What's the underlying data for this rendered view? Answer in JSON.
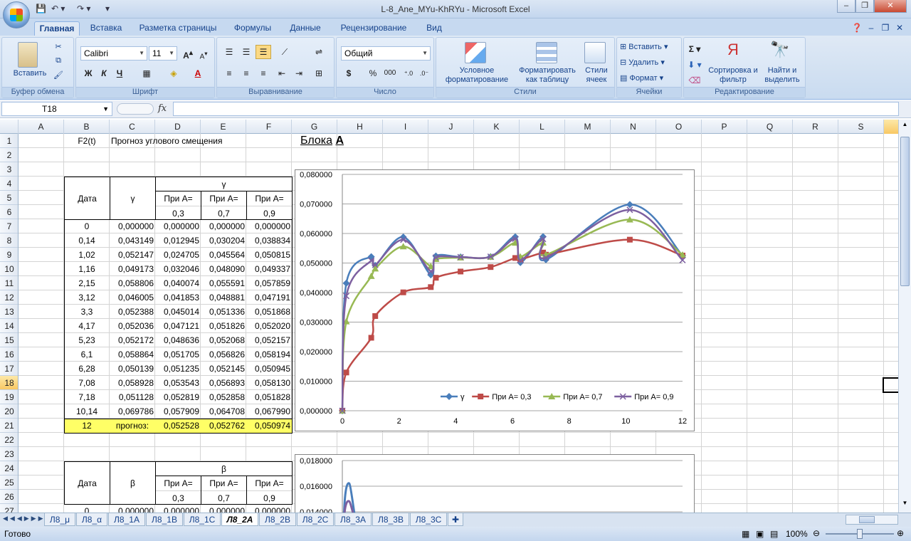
{
  "window": {
    "title": "L-8_Ane_MYu-KhRYu - Microsoft Excel",
    "min": "‒",
    "max": "❐",
    "close": "✕"
  },
  "ribbon": {
    "tabs": [
      "Главная",
      "Вставка",
      "Разметка страницы",
      "Формулы",
      "Данные",
      "Рецензирование",
      "Вид"
    ],
    "clipboard": {
      "paste": "Вставить",
      "label": "Буфер обмена"
    },
    "font": {
      "name": "Calibri",
      "size": "11",
      "label": "Шрифт",
      "bold": "Ж",
      "italic": "К",
      "underline": "Ч"
    },
    "alignment": {
      "label": "Выравнивание"
    },
    "number": {
      "format": "Общий",
      "label": "Число",
      "percent": "%",
      "thousands": "000"
    },
    "styles": {
      "conditional": "Условное форматирование",
      "as_table": "Форматировать как таблицу",
      "cell_styles": "Стили ячеек",
      "label": "Стили"
    },
    "cells": {
      "insert": "Вставить",
      "delete": "Удалить",
      "format": "Формат",
      "label": "Ячейки"
    },
    "editing": {
      "sort": "Сортировка и фильтр",
      "find": "Найти и выделить",
      "label": "Редактирование"
    }
  },
  "formula_bar": {
    "name_box": "T18",
    "fx": "fx",
    "value": ""
  },
  "columns": [
    "A",
    "B",
    "C",
    "D",
    "E",
    "F",
    "G",
    "H",
    "I",
    "J",
    "K",
    "L",
    "M",
    "N",
    "O",
    "P",
    "Q",
    "R",
    "S",
    "T"
  ],
  "selected_column": "T",
  "selected_row": "18",
  "rows": [
    "1",
    "2",
    "3",
    "4",
    "5",
    "6",
    "7",
    "8",
    "9",
    "10",
    "11",
    "12",
    "13",
    "14",
    "15",
    "16",
    "17",
    "18",
    "19",
    "20",
    "21",
    "22",
    "23",
    "24",
    "25",
    "26",
    "27"
  ],
  "sheet": {
    "b1": "F2(t)",
    "c1": "Прогноз углового смещения",
    "g1a": "Блока",
    "g1b": "А",
    "table1": {
      "gamma_header": "γ",
      "col_date": "Дата",
      "col_gamma": "γ",
      "pri_a": "При А=",
      "a_values": [
        "0,3",
        "0,7",
        "0,9"
      ],
      "rows": [
        [
          "0",
          "0,000000",
          "0,000000",
          "0,000000",
          "0,000000"
        ],
        [
          "0,14",
          "0,043149",
          "0,012945",
          "0,030204",
          "0,038834"
        ],
        [
          "1,02",
          "0,052147",
          "0,024705",
          "0,045564",
          "0,050815"
        ],
        [
          "1,16",
          "0,049173",
          "0,032046",
          "0,048090",
          "0,049337"
        ],
        [
          "2,15",
          "0,058806",
          "0,040074",
          "0,055591",
          "0,057859"
        ],
        [
          "3,12",
          "0,046005",
          "0,041853",
          "0,048881",
          "0,047191"
        ],
        [
          "3,3",
          "0,052388",
          "0,045014",
          "0,051336",
          "0,051868"
        ],
        [
          "4,17",
          "0,052036",
          "0,047121",
          "0,051826",
          "0,052020"
        ],
        [
          "5,23",
          "0,052172",
          "0,048636",
          "0,052068",
          "0,052157"
        ],
        [
          "6,1",
          "0,058864",
          "0,051705",
          "0,056826",
          "0,058194"
        ],
        [
          "6,28",
          "0,050139",
          "0,051235",
          "0,052145",
          "0,050945"
        ],
        [
          "7,08",
          "0,058928",
          "0,053543",
          "0,056893",
          "0,058130"
        ],
        [
          "7,18",
          "0,051128",
          "0,052819",
          "0,052858",
          "0,051828"
        ],
        [
          "10,14",
          "0,069786",
          "0,057909",
          "0,064708",
          "0,067990"
        ]
      ],
      "forecast": [
        "12",
        "прогноз:",
        "0,052528",
        "0,052762",
        "0,050974"
      ]
    },
    "table2": {
      "beta_header": "β",
      "col_date": "Дата",
      "col_beta": "β",
      "pri_a": "При А=",
      "a_values": [
        "0,3",
        "0,7",
        "0,9"
      ],
      "partial_row": [
        "0",
        "0,000000",
        "0,000000",
        "0,000000",
        "0,000000"
      ]
    }
  },
  "chart_data": [
    {
      "type": "scatter",
      "title": "",
      "xlabel": "",
      "ylabel": "",
      "xlim": [
        0,
        12
      ],
      "ylim": [
        0,
        0.08
      ],
      "x_ticks": [
        "0",
        "2",
        "4",
        "6",
        "8",
        "10",
        "12"
      ],
      "y_ticks": [
        "0,000000",
        "0,010000",
        "0,020000",
        "0,030000",
        "0,040000",
        "0,050000",
        "0,060000",
        "0,070000",
        "0,080000"
      ],
      "grid": true,
      "legend": "bottom-right",
      "x": [
        0,
        0.14,
        1.02,
        1.16,
        2.15,
        3.12,
        3.3,
        4.17,
        5.23,
        6.1,
        6.28,
        7.08,
        7.18,
        10.14,
        12
      ],
      "series": [
        {
          "name": "γ",
          "color": "#4a7ebb",
          "marker": "diamond",
          "values": [
            0,
            0.043149,
            0.052147,
            0.049173,
            0.058806,
            0.046005,
            0.052388,
            0.052036,
            0.052172,
            0.058864,
            0.050139,
            0.058928,
            0.051128,
            0.069786,
            0.052528
          ]
        },
        {
          "name": "При А= 0,3",
          "color": "#be4b48",
          "marker": "square",
          "values": [
            0,
            0.012945,
            0.024705,
            0.032046,
            0.040074,
            0.041853,
            0.045014,
            0.047121,
            0.048636,
            0.051705,
            0.051235,
            0.053543,
            0.052819,
            0.057909,
            0.052528
          ]
        },
        {
          "name": "При А= 0,7",
          "color": "#98b954",
          "marker": "triangle",
          "values": [
            0,
            0.030204,
            0.045564,
            0.04809,
            0.055591,
            0.048881,
            0.051336,
            0.051826,
            0.052068,
            0.056826,
            0.052145,
            0.056893,
            0.052858,
            0.064708,
            0.052762
          ]
        },
        {
          "name": "При А= 0,9",
          "color": "#7d60a0",
          "marker": "x",
          "values": [
            0,
            0.038834,
            0.050815,
            0.049337,
            0.057859,
            0.047191,
            0.051868,
            0.05202,
            0.052157,
            0.058194,
            0.050945,
            0.05813,
            0.051828,
            0.06799,
            0.050974
          ]
        }
      ]
    },
    {
      "type": "scatter",
      "title": "",
      "ylim": [
        0.014,
        0.018
      ],
      "y_ticks": [
        "0,018000",
        "0,016000",
        "0,014000"
      ],
      "grid": true,
      "note_partial": true,
      "series": [
        {
          "name": "β",
          "color": "#4a7ebb",
          "peak": 0.0162
        },
        {
          "name": "При А= 0,9",
          "color": "#7d60a0",
          "peak": 0.0148
        }
      ]
    }
  ],
  "sheet_tabs": [
    "Л8_μ",
    "Л8_α",
    "Л8_1А",
    "Л8_1В",
    "Л8_1С",
    "Л8_2А",
    "Л8_2В",
    "Л8_2С",
    "Л8_3А",
    "Л8_3В",
    "Л8_3С"
  ],
  "active_sheet": "Л8_2А",
  "status": {
    "ready": "Готово",
    "zoom": "100%"
  }
}
